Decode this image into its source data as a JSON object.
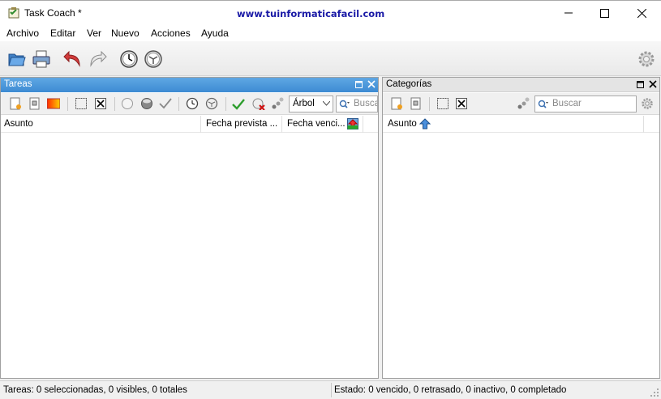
{
  "window": {
    "title": "Task Coach *",
    "watermark": "www.tuinformaticafacil.com"
  },
  "menu": [
    "Archivo",
    "Editar",
    "Ver",
    "Nuevo",
    "Acciones",
    "Ayuda"
  ],
  "toolbar": {
    "icons": [
      "open-folder-icon",
      "print-icon",
      "undo-icon",
      "redo-icon",
      "clock-icon",
      "clock-stop-icon",
      "settings-gear-icon"
    ]
  },
  "tasks_pane": {
    "title": "Tareas",
    "view_mode": "Árbol",
    "search_placeholder": "Buscar",
    "columns": [
      "Asunto",
      "Fecha prevista ...",
      "Fecha venci..."
    ]
  },
  "categories_pane": {
    "title": "Categorías",
    "search_placeholder": "Buscar",
    "columns": [
      "Asunto"
    ]
  },
  "status": {
    "left": "Tareas: 0 seleccionadas, 0 visibles, 0 totales",
    "right": "Estado: 0 vencido, 0 retrasado, 0 inactivo, 0 completado"
  },
  "colors": {
    "active_header": "#3d8bd3",
    "inactive_header": "#e4e4e4"
  }
}
